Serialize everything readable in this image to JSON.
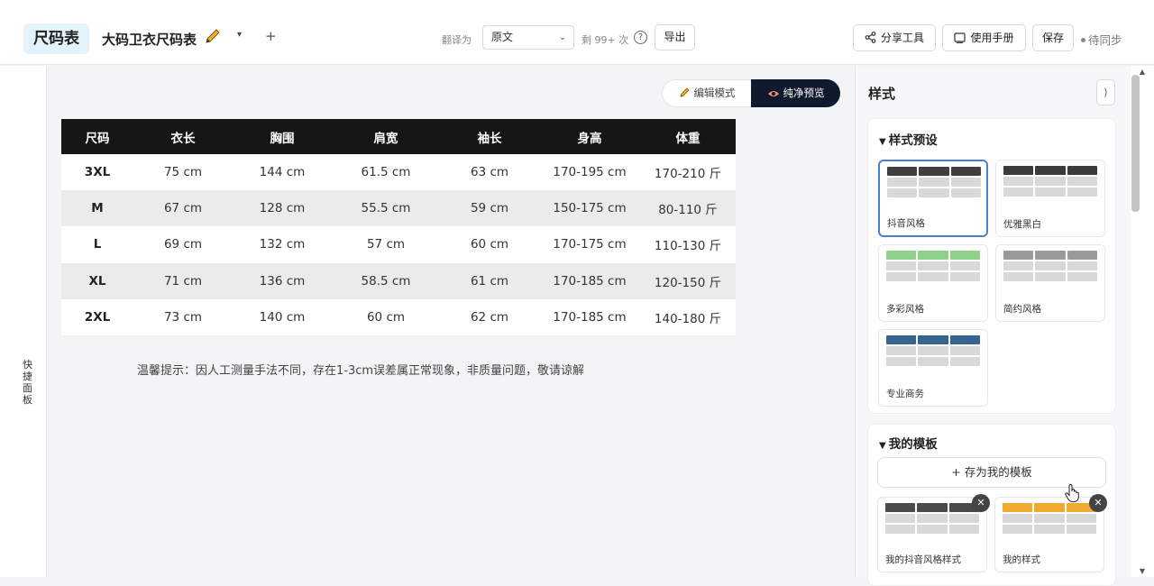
{
  "header": {
    "app_name": "尺码表",
    "doc_title": "大码卫衣尺码表",
    "translate_label": "翻译为",
    "translate_value": "原文",
    "remaining": "剩 99+ 次",
    "help": "?",
    "export_label": "导出",
    "share_label": "分享工具",
    "manual_label": "使用手册",
    "save_label": "保存",
    "sync_status": "待同步"
  },
  "quick_panel": {
    "label": "快捷面板"
  },
  "mode_toggle": {
    "edit_label": "编辑模式",
    "preview_label": "纯净预览",
    "active": "preview"
  },
  "table": {
    "headers": [
      "尺码",
      "衣长",
      "胸围",
      "肩宽",
      "袖长",
      "身高",
      "体重"
    ],
    "rows": [
      [
        "3XL",
        "75 cm",
        "144 cm",
        "61.5 cm",
        "63 cm",
        "170-195 cm",
        "170-210 斤"
      ],
      [
        "M",
        "67 cm",
        "128 cm",
        "55.5 cm",
        "59 cm",
        "150-175 cm",
        "80-110 斤"
      ],
      [
        "L",
        "69 cm",
        "132 cm",
        "57 cm",
        "60 cm",
        "170-175 cm",
        "110-130 斤"
      ],
      [
        "XL",
        "71 cm",
        "136 cm",
        "58.5 cm",
        "61 cm",
        "170-185 cm",
        "120-150 斤"
      ],
      [
        "2XL",
        "73 cm",
        "140 cm",
        "60 cm",
        "62 cm",
        "170-185 cm",
        "140-180 斤"
      ]
    ],
    "header_bg": "#161616",
    "stripe_bg": "#ebebeb"
  },
  "tip": "温馨提示：因人工测量手法不同，存在1-3cm误差属正常现象，非质量问题，敬请谅解",
  "style_panel": {
    "title": "样式",
    "collapse": "⟩",
    "presets_title": "样式预设",
    "presets": [
      {
        "label": "抖音风格",
        "header_color": "#3f3f3f",
        "selected": true
      },
      {
        "label": "优雅黑白",
        "header_color": "#3a3a3a",
        "selected": false
      },
      {
        "label": "多彩风格",
        "header_color": "#8fd08a",
        "selected": false
      },
      {
        "label": "简约风格",
        "header_color": "#9a9a9a",
        "selected": false
      },
      {
        "label": "专业商务",
        "header_color": "#37638f",
        "selected": false
      }
    ],
    "templates_title": "我的模板",
    "save_template_label": "+ 存为我的模板",
    "templates": [
      {
        "label": "我的抖音风格样式",
        "header_color": "#4a4a4a"
      },
      {
        "label": "我的样式",
        "header_color": "#f0a931"
      }
    ]
  }
}
